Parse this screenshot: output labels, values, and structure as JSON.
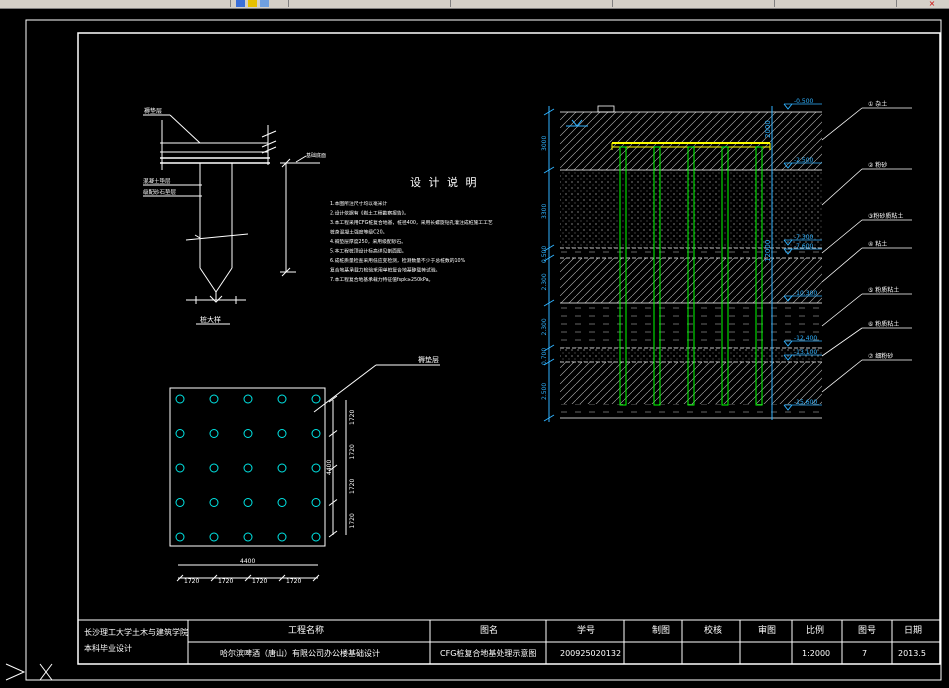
{
  "title_block": {
    "school_line1": "长沙理工大学土木与建筑学院",
    "school_line2": "本科毕业设计",
    "project_name_header": "工程名称",
    "project_name": "哈尔滨啤酒（唐山）有限公司办公楼基础设计",
    "drawing_name_header": "图名",
    "drawing_name": "CFG桩复合地基处理示意图",
    "student_id_header": "学号",
    "student_id": "200925020132",
    "drawn_header": "制图",
    "checked_header": "校核",
    "reviewed_header": "审图",
    "scale_header": "比例",
    "scale": "1:2000",
    "sheet_header": "图号",
    "sheet_no": "7",
    "date_header": "日期",
    "date": "2013.5"
  },
  "notes": {
    "title": "设 计 说 明",
    "lines": [
      "1.本图所注尺寸均以毫米计",
      "2.设计依据有《岩土工程勘察报告》。",
      "3.本工程采用CFG桩复合地基，桩径400，采用长螺旋钻孔灌注成桩施工工艺",
      "  桩身混凝土强度等级C20。",
      "4.褥垫层厚度250，采用级配砂石。",
      "5.本工程桩顶设计标高详见剖面图。",
      "6.成桩质量检查采用低应变检测，检测数量不少于总桩数的10%",
      "  复合地基承载力检验采用单桩复合地基静载荷试验。",
      "7.本工程复合地基承载力特征值fspk≥250kPa。"
    ]
  },
  "pile_detail": {
    "label_top": "褥垫层",
    "label_mid1": "混凝土垫层",
    "label_mid2": "级配砂石垫层",
    "label_right": "基础底面",
    "caption": "桩大样"
  },
  "plan": {
    "label": "褥垫层",
    "dim_right": [
      "1720",
      "1720",
      "1720",
      "1720"
    ],
    "dim_total_right": "4400",
    "dim_bottom_total": "4400",
    "dim_bottom": [
      "1720",
      "1720",
      "1720",
      "1720"
    ],
    "grid": 5
  },
  "section": {
    "elevations": [
      "-0.500",
      "-2.500",
      "-7.300",
      "-7.600",
      "-10.300",
      "-12.400",
      "-13.100",
      "-15.600"
    ],
    "thickness_left": [
      "3000",
      "3300",
      "0.500",
      "2.300",
      "2.300",
      "0.700",
      "2.500"
    ],
    "pile_length": "12000",
    "pile_top_dim": "2000",
    "layers": [
      "① 杂土",
      "② 粉砂",
      "③粉砂质粘土",
      "④ 粘土",
      "⑤ 粉质粘土",
      "⑥ 粉质粘土",
      "⑦ 细粉砂"
    ]
  }
}
